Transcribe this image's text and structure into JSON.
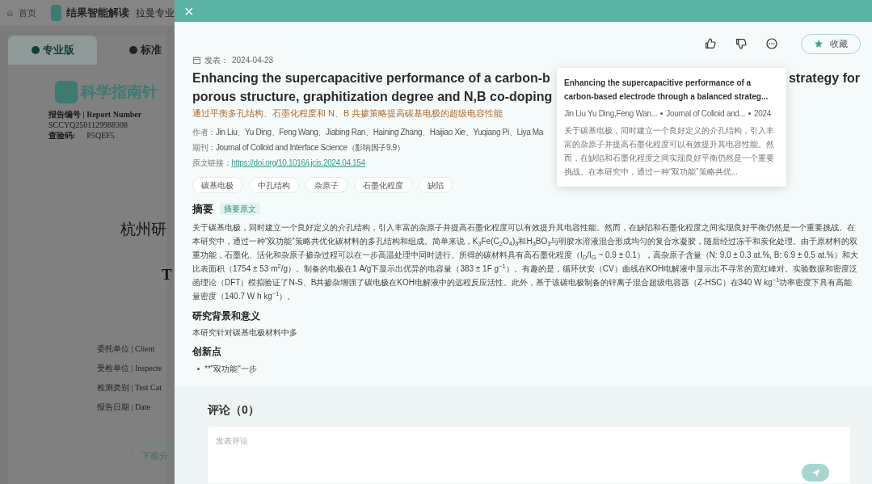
{
  "background_page": {
    "nav": {
      "home": "首页",
      "app_title": "结果智能解读",
      "cut_title": "拉曼专业"
    },
    "version_tabs": [
      {
        "label": "专业版",
        "selected": true
      },
      {
        "label": "标准",
        "selected": false
      }
    ],
    "logo_text": "科学指南针",
    "report_number_label": "报告编号 | Report Number",
    "report_number": "SCCYQ2501129988308",
    "check_code_label": "查验码:",
    "check_code": "P5QEF5",
    "company_cut": "杭州研",
    "english_cut": "T",
    "fields": [
      "委托单位 | Client",
      "受检单位 | Inspecte",
      "检测类别 | Test Cat",
      "报告日期 | Date"
    ],
    "download_button": "下载分"
  },
  "drawer": {
    "close": "×",
    "publish_label": "发表：",
    "publish_date": "2024-04-23",
    "title_parts": [
      "Enhancing the supercapacitive performance of a carbon-b",
      "strategy for",
      "porous structure, graphitization degree and N,B co-doping"
    ],
    "translated_title": "通过平衡多孔结构、石墨化程度和 N、B 共掺策略提高碳基电极的超级电容性能",
    "meta": [
      {
        "kind": "text",
        "label": "作者：",
        "value": "Jin Liu、Yu Ding、Feng Wang、Jiabing Ran、Haining Zhang、Haijiao Xie、Yuqiang Pi、Liya Ma"
      },
      {
        "kind": "text",
        "label": "期刊：",
        "value": "Journal of Colloid and Interface Science（影响因子9.9）"
      },
      {
        "kind": "link",
        "label": "原文链接：",
        "value": "https://doi.org/10.1016/j.jcis.2024.04.154"
      }
    ],
    "tags": [
      "碳基电极",
      "中孔结构",
      "杂原子",
      "石墨化程度",
      "缺陷"
    ],
    "collect_button": "收藏",
    "abstract": {
      "heading": "摘要",
      "badge": "摘要原文",
      "text": "关于碳基电极，同时建立一个良好定义的介孔结构，引入丰富的杂原子并提高石墨化程度可以有效提升其电容性能。然而，在缺陷和石墨化程度之间实现良好平衡仍然是一个重要挑战。在本研究中，通过一种“双功能”策略共优化碳材料的多孔结构和组成。简单来说，K$_{3}$Fe(C$_{2}$O$_{4}$)$_{3}$和H$_{3}$BO$_{3}$与明胶水溶液混合形成均匀的复合水凝胶，随后经过冻干和炭化处理。由于原材料的双重功能，石墨化、活化和杂原子掺杂过程可以在一步高温处理中同时进行。所得的碳材料具有高石墨化程度（I$_{D}$/I$_{G}$ ~ 0.9 ± 0.1），高杂原子含量（N: 9.0 ± 0.3 at.%, B: 6.9 ± 0.5 at.%）和大比表面积（1754 ± 53 m$^{2}$/g）。制备的电极在1 A/g下显示出优异的电容量（383 ± 1F g$^{−1}$）。有趣的是，循环伏安（CV）曲线在KOH电解液中显示出不寻常的宽红峰对。实验数据和密度泛函理论（DFT）模拟验证了N-S、B共掺杂增强了碳电极在KOH电解液中的远程反应活性。此外，基于该碳电极制备的锌离子混合超级电容器（Z-HSC）在340 W kg$^{−1}$功率密度下具有高能量密度（140.7 W h kg$^{−1}$）。"
    },
    "sections": [
      {
        "heading": "研究背景和意义",
        "kind": "paragraph",
        "items": [
          "本研究针对碳基电极材料中多"
        ]
      },
      {
        "heading": "创新点",
        "kind": "bullets",
        "items": [
          "**\"双功能\"一步"
        ]
      }
    ],
    "tooltip": {
      "title": "Enhancing the supercapacitive performance of a carbon-based electrode through a balanced strateg...",
      "meta": [
        "Jin Liu Yu Ding,Feng Wan...",
        "Journal of Colloid and...",
        "2024"
      ],
      "snippet": "关于碳基电极，同时建立一个良好定义的介孔结构，引入丰富的杂原子并提高石墨化程度可以有效提升其电容性能。然而，在缺陷和石墨化程度之间实现良好平衡仍然是一个重要挑战。在本研究中，通过一种“双功能”策略共优..."
    },
    "comments": {
      "title": "评论（0）",
      "placeholder": "发表评论"
    }
  }
}
